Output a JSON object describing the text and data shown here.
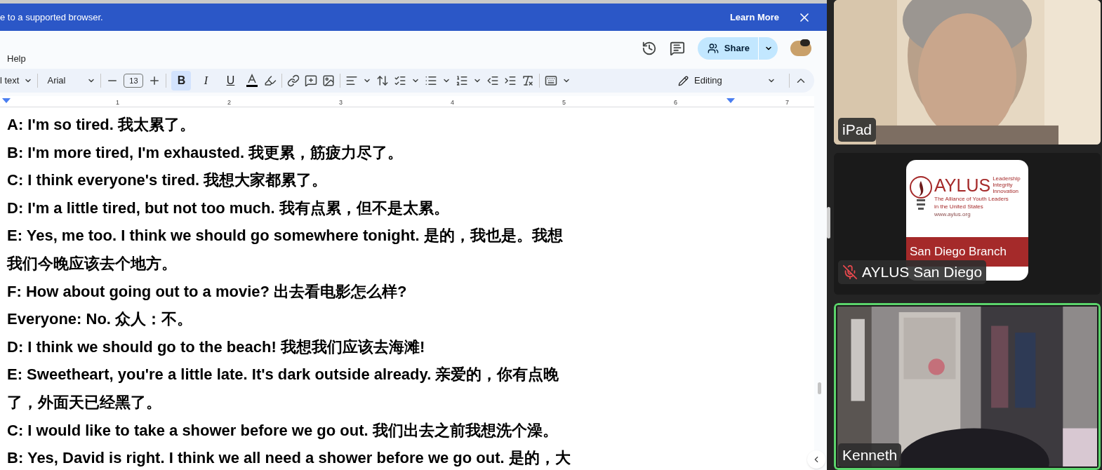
{
  "banner": {
    "text": "e to a supported browser.",
    "link": "Learn More"
  },
  "menu": [
    "Help"
  ],
  "toolbar": {
    "style": "l text",
    "font": "Arial",
    "size": "13",
    "bold": {
      "label": "B",
      "selected": true
    },
    "italic": {
      "label": "I",
      "selected": false
    },
    "underline": {
      "label": "U",
      "selected": false
    },
    "mode": "Editing"
  },
  "share": {
    "label": "Share"
  },
  "ruler": [
    "1",
    "2",
    "3",
    "4",
    "5",
    "6",
    "7"
  ],
  "paragraphs": [
    {
      "lines": [
        "A: I'm so tired. 我太累了。"
      ]
    },
    {
      "lines": [
        "B: I'm more tired, I'm exhausted. 我更累，筋疲力尽了。"
      ]
    },
    {
      "lines": [
        "C: I think everyone's tired. 我想大家都累了。"
      ]
    },
    {
      "lines": [
        "D: I'm a little tired, but not too much. 我有点累，但不是太累。"
      ]
    },
    {
      "lines": [
        "E: Yes, me too. I think we should go somewhere tonight. 是的，我也是。我想",
        "我们今晚应该去个地方。"
      ]
    },
    {
      "lines": [
        "F: How about going out to a movie? 出去看电影怎么样?"
      ]
    },
    {
      "lines": [
        "Everyone: No. 众人：不。"
      ]
    },
    {
      "lines": [
        "D: I think we should go to the beach! 我想我们应该去海滩!"
      ]
    },
    {
      "lines": [
        "E: Sweetheart, you're a little late. It's dark outside already. 亲爱的，你有点晚",
        "了，外面天已经黑了。"
      ]
    },
    {
      "lines": [
        "C: I would like to take a shower before we go out. 我们出去之前我想洗个澡。"
      ]
    },
    {
      "lines": [
        "B: Yes, David is right. I think we all need a shower before we go out. 是的，大"
      ]
    }
  ],
  "participants": [
    {
      "name": "iPad",
      "kind": "video",
      "muted": false,
      "speaking": false
    },
    {
      "name": "AYLUS San Diego",
      "kind": "logo",
      "muted": true,
      "speaking": false,
      "logo": {
        "title": "AYLUS",
        "motto": [
          "Leadership",
          "Integrity",
          "Innovation"
        ],
        "subtitle": [
          "The Alliance of Youth Leaders",
          "in the United States"
        ],
        "url": "www.aylus.org",
        "branch": "San Diego Branch"
      }
    },
    {
      "name": "Kenneth",
      "kind": "room",
      "muted": false,
      "speaking": true
    }
  ]
}
